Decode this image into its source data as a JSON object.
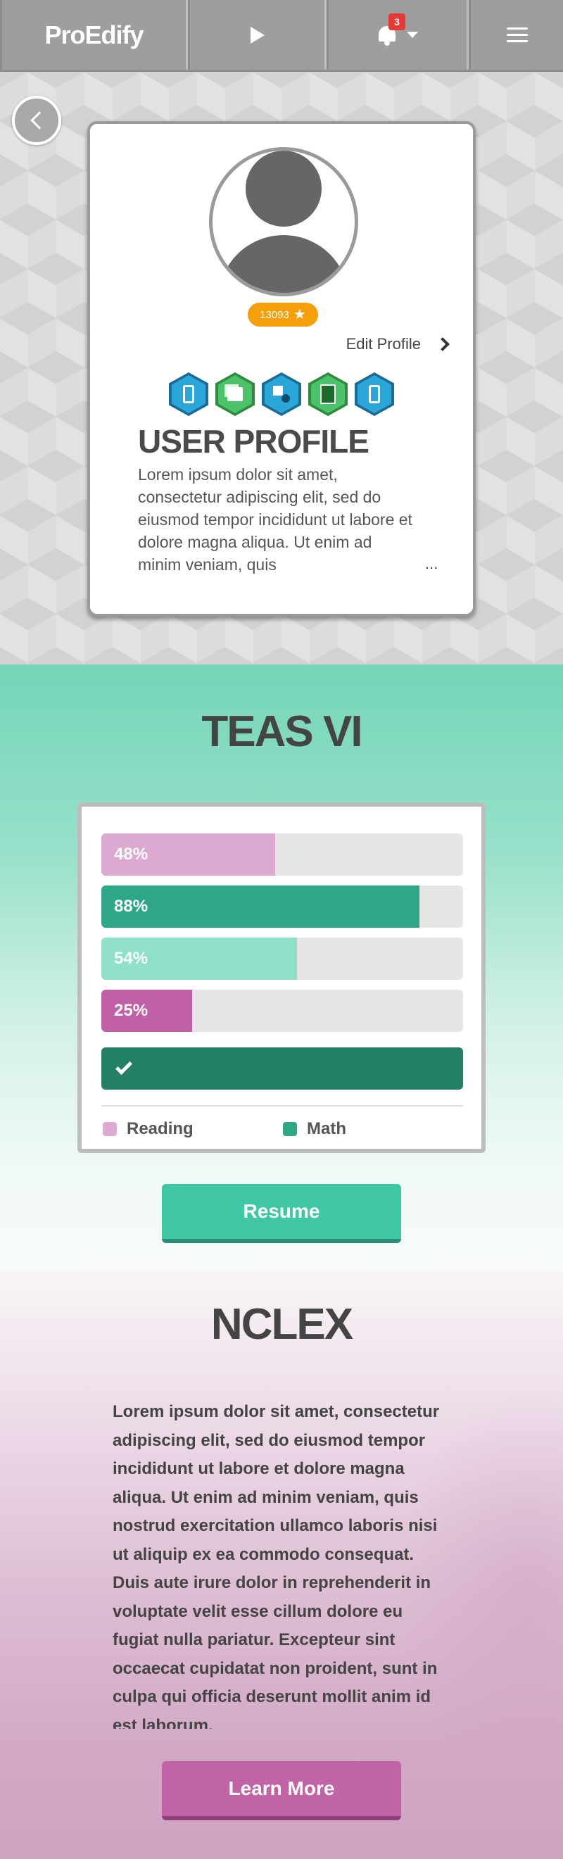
{
  "nav": {
    "logo_text": "ProEdify",
    "notification_count": "3",
    "icons": [
      "play-icon",
      "bell-icon",
      "chevron-down-icon",
      "hamburger-menu-icon"
    ]
  },
  "profile": {
    "points": "13093",
    "edit_label": "Edit Profile",
    "title": "USER PROFILE",
    "bio": "Lorem ipsum dolor sit amet, consectetur adipiscing elit, sed do eiusmod tempor incididunt ut labore et dolore magna aliqua. Ut enim ad minim veniam, quis",
    "more": "...",
    "badges": [
      "mobile-badge-icon",
      "flashcards-badge-icon",
      "shapes-badge-icon",
      "book-badge-icon",
      "mobile-badge-icon"
    ]
  },
  "teas": {
    "title": "TEAS VI",
    "bars": [
      {
        "label": "48%",
        "value": 48,
        "color": "#dca9d1"
      },
      {
        "label": "88%",
        "value": 88,
        "color": "#2fa685"
      },
      {
        "label": "54%",
        "value": 54,
        "color": "#8fe0c8"
      },
      {
        "label": "25%",
        "value": 25,
        "color": "#c060a6"
      },
      {
        "label": "",
        "value": 100,
        "color": "#237f66"
      }
    ],
    "legend": [
      {
        "label": "Reading",
        "color": "#dca9d1"
      },
      {
        "label": "Math",
        "color": "#2fa685"
      }
    ],
    "resume_label": "Resume"
  },
  "nclex": {
    "title": "NCLEX",
    "body": "Lorem ipsum dolor sit amet, consectetur adipiscing elit, sed do eiusmod tempor incididunt ut labore et dolore magna aliqua. Ut enim ad minim veniam, quis nostrud exercitation ullamco laboris nisi ut aliquip ex ea commodo consequat. Duis aute irure dolor in reprehenderit in voluptate velit esse cillum dolore eu fugiat nulla pariatur. Excepteur sint occaecat cupidatat non proident, sunt in culpa qui officia deserunt mollit anim id est laborum.",
    "learn_more_label": "Learn More"
  }
}
